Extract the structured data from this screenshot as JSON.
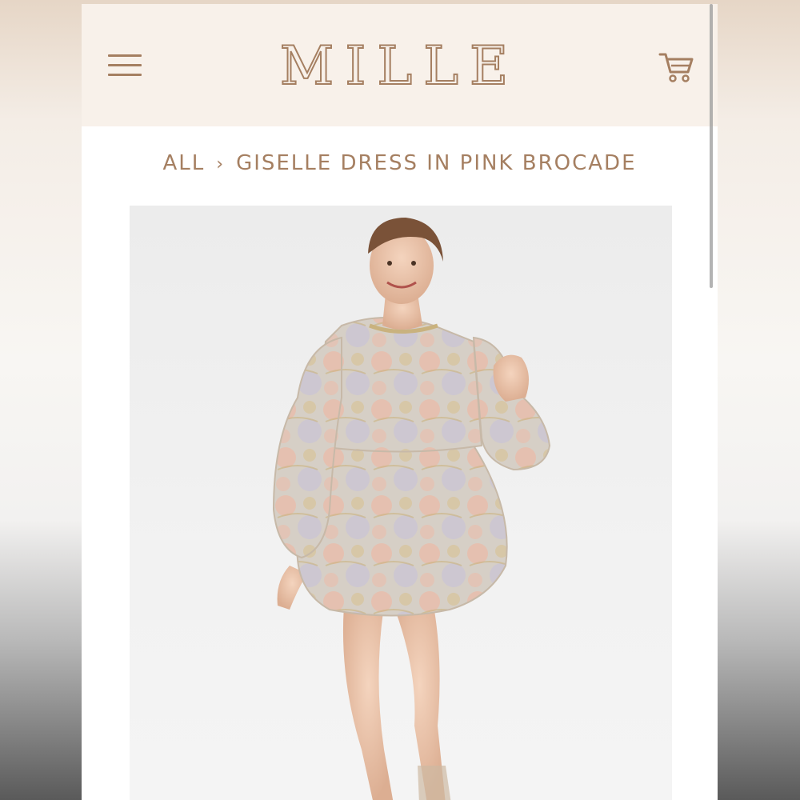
{
  "header": {
    "logo_text": "MILLE",
    "menu_icon": "hamburger-icon",
    "cart_icon": "cart-icon"
  },
  "breadcrumb": {
    "root_label": "ALL",
    "separator": "›",
    "current_label": "GISELLE DRESS IN PINK BROCADE"
  },
  "product": {
    "image_alt": "Model wearing a pink brocade mini dress with puff sleeves"
  },
  "colors": {
    "brand": "#a57f61",
    "header_bg": "#f8f1ea",
    "dress_pink": "#e6bfb0",
    "dress_silver": "#cfcdc6"
  }
}
